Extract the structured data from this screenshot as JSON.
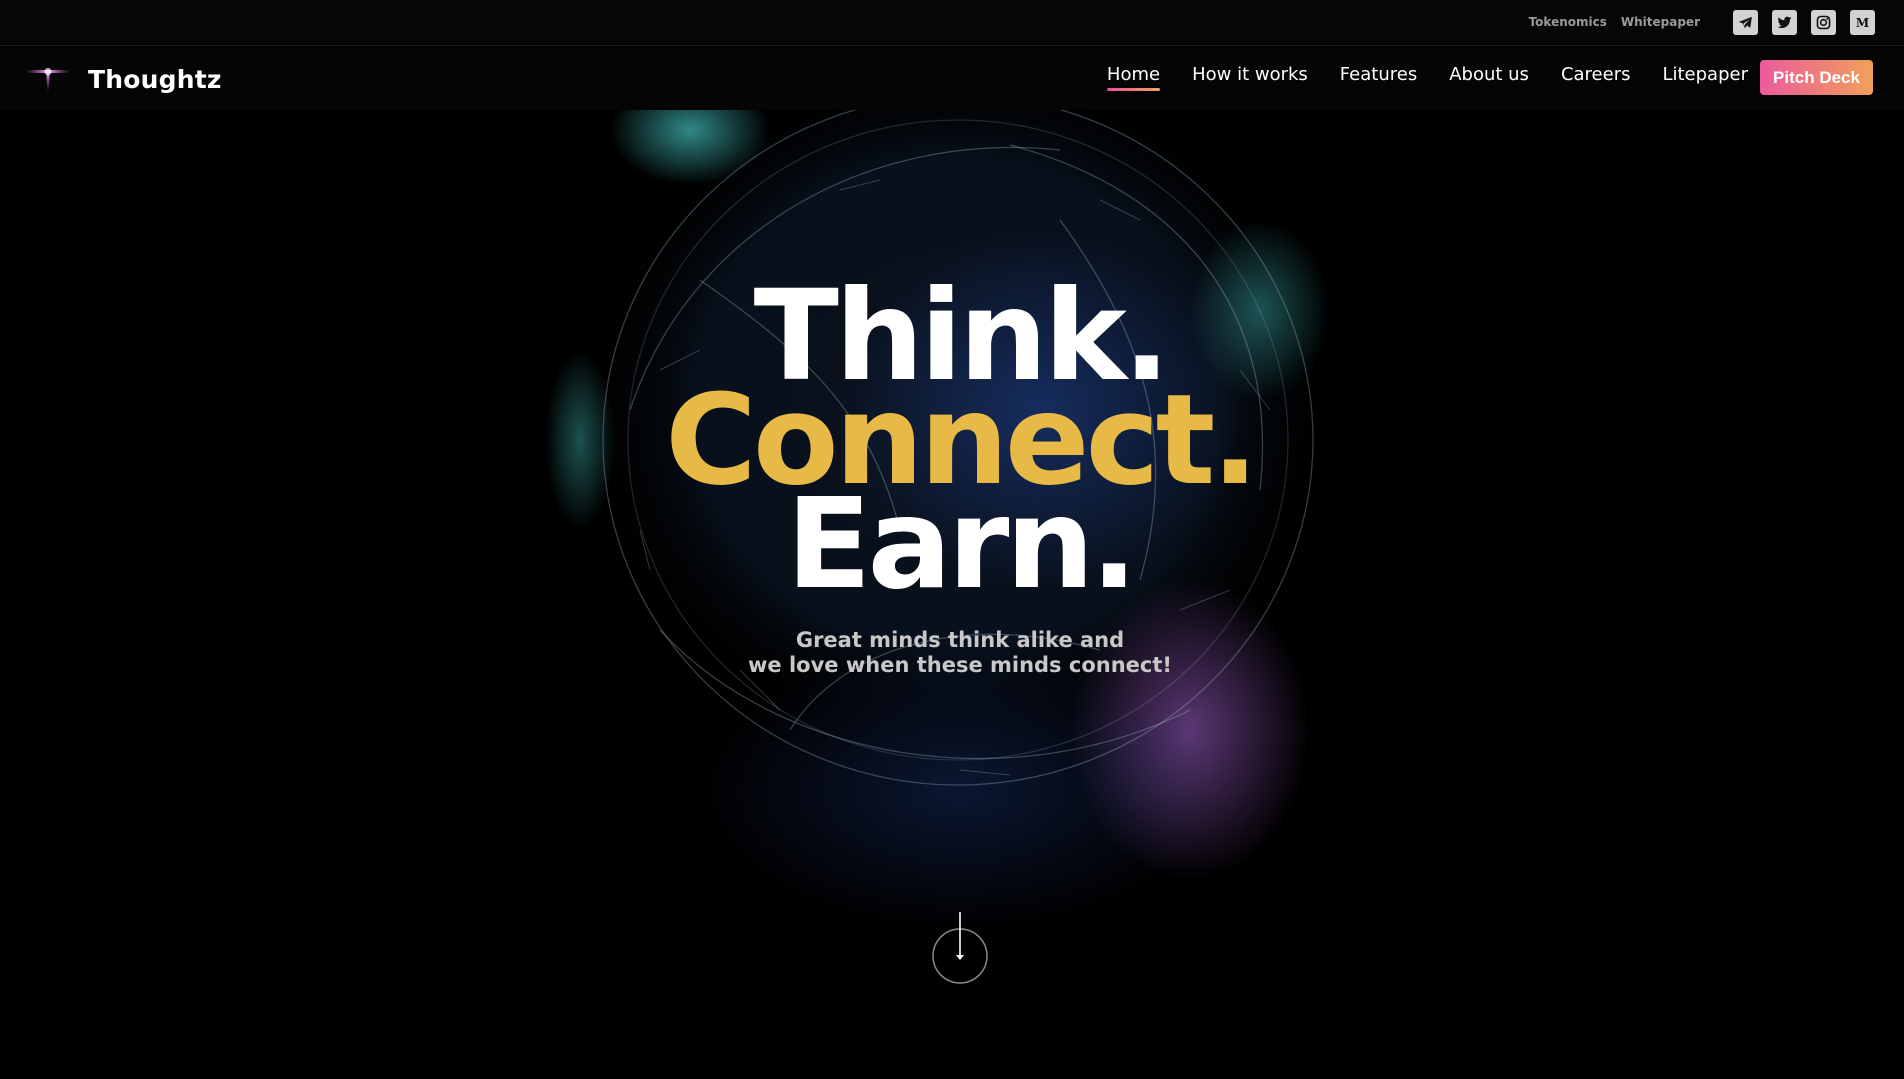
{
  "utility_bar": {
    "links": [
      "Tokenomics",
      "Whitepaper"
    ],
    "social": [
      {
        "name": "telegram-icon"
      },
      {
        "name": "twitter-icon"
      },
      {
        "name": "instagram-icon"
      },
      {
        "name": "medium-icon",
        "letter": "M"
      }
    ]
  },
  "header": {
    "brand": "Thoughtz",
    "nav": [
      {
        "label": "Home",
        "active": true
      },
      {
        "label": "How it works",
        "active": false
      },
      {
        "label": "Features",
        "active": false
      },
      {
        "label": "About us",
        "active": false
      },
      {
        "label": "Careers",
        "active": false
      },
      {
        "label": "Litepaper",
        "active": false
      }
    ],
    "cta": "Pitch Deck"
  },
  "hero": {
    "line1": "Think.",
    "line2": "Connect.",
    "line3": "Earn.",
    "subtitle_line1": "Great minds think alike and",
    "subtitle_line2": "we love when these minds connect!"
  },
  "colors": {
    "background": "#000000",
    "gold": "#e7b946",
    "cta_gradient_start": "#ec5a9c",
    "cta_gradient_end": "#f0a05a"
  }
}
